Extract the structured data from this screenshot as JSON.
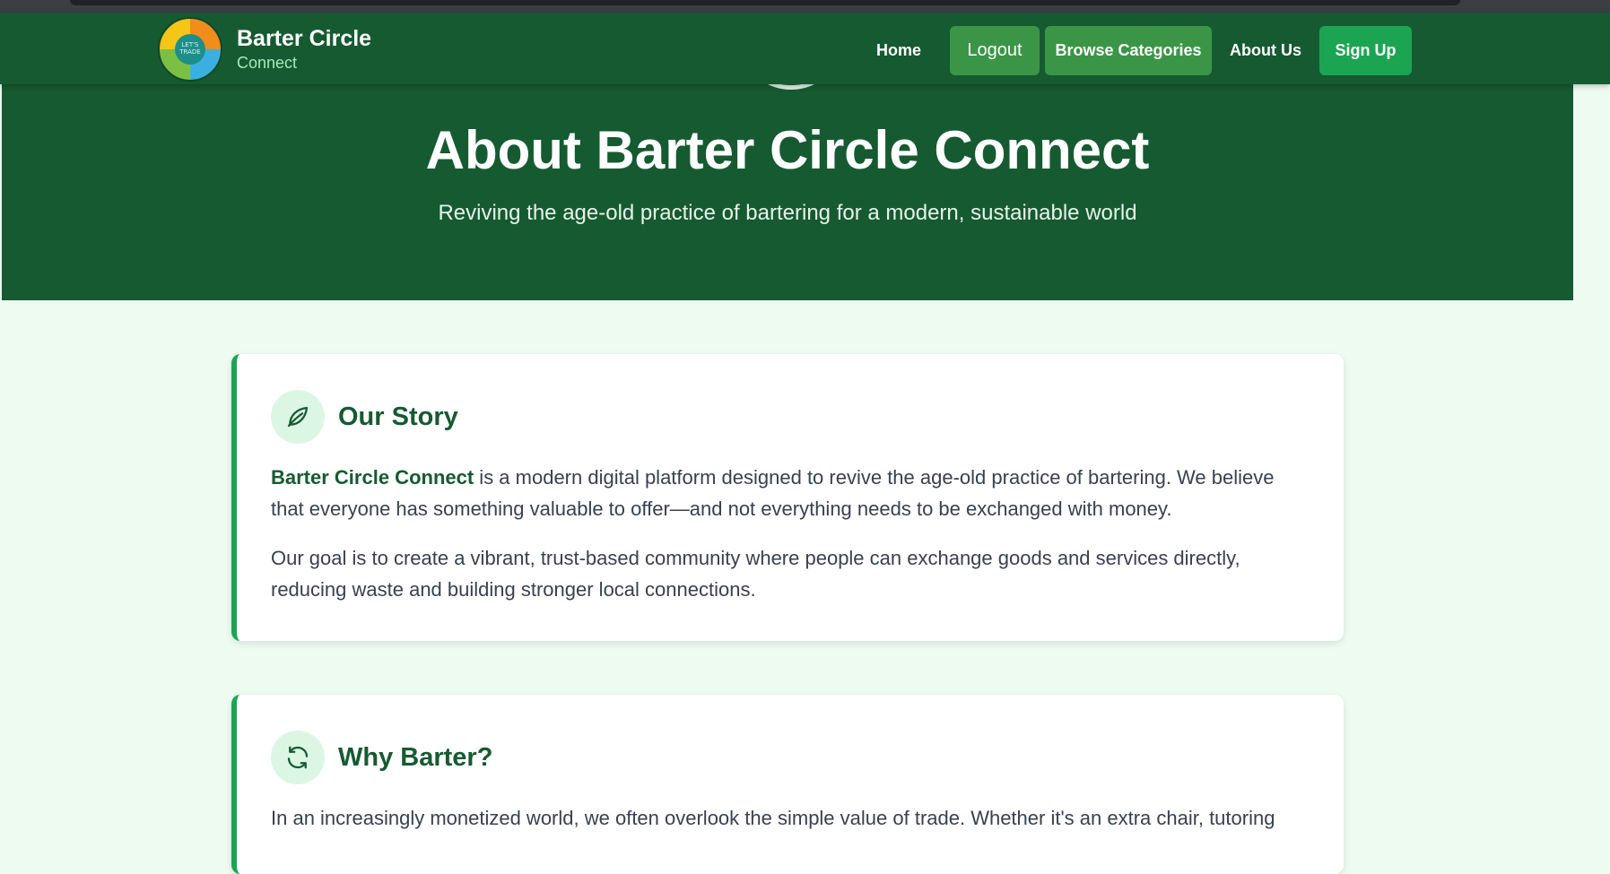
{
  "nav": {
    "brand_name": "Barter Circle",
    "brand_tag": "Connect",
    "logo_text": "LET'S TRADE",
    "links": {
      "home": "Home",
      "logout": "Logout",
      "browse": "Browse Categories",
      "about": "About Us",
      "signup": "Sign Up"
    }
  },
  "hero": {
    "title": "About Barter Circle Connect",
    "subtitle": "Reviving the age-old practice of bartering for a modern, sustainable world"
  },
  "sections": {
    "story": {
      "title": "Our Story",
      "icon": "leaf-icon",
      "p1_highlight": "Barter Circle Connect",
      "p1_rest": " is a modern digital platform designed to revive the age-old practice of bartering. We believe that everyone has something valuable to offer—and not everything needs to be exchanged with money.",
      "p2": "Our goal is to create a vibrant, trust-based community where people can exchange goods and services directly, reducing waste and building stronger local connections."
    },
    "why": {
      "title": "Why Barter?",
      "icon": "refresh-icon",
      "p1": "In an increasingly monetized world, we often overlook the simple value of trade. Whether it's an extra chair, tutoring"
    }
  },
  "colors": {
    "primary_dark": "#165a31",
    "accent_green": "#1ba552",
    "button_green": "#3a9646",
    "page_bg": "#edfbf1"
  }
}
